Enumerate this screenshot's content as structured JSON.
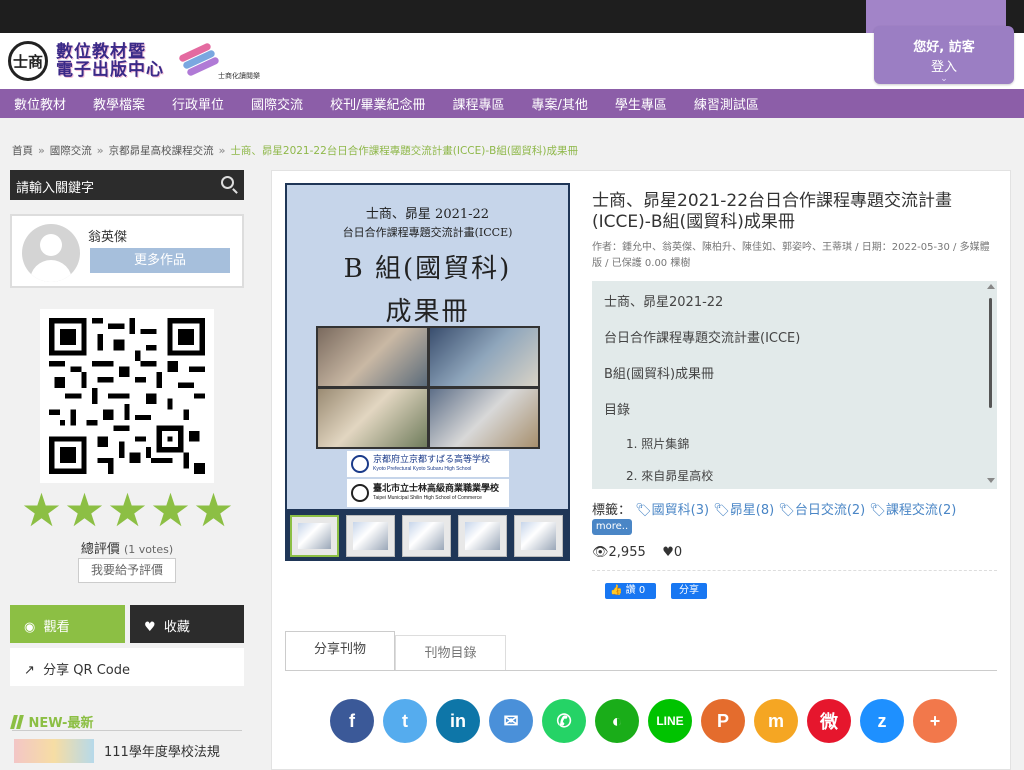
{
  "header": {
    "logo_seal": "士商",
    "logo_line1": "數位教材暨",
    "logo_line2": "電子出版中心",
    "logo_sub": "士商化讀閱樂",
    "greeting": "您好, 訪客",
    "login_label": "登入"
  },
  "nav": [
    "數位教材",
    "教學檔案",
    "行政單位",
    "國際交流",
    "校刊/畢業紀念冊",
    "課程專區",
    "專案/其他",
    "學生專區",
    "練習測試區"
  ],
  "breadcrumb": {
    "items": [
      "首頁",
      "國際交流",
      "京都昴星高校課程交流"
    ],
    "current": "士商、昴星2021-22台日合作課程專題交流計畫(ICCE)-B組(國貿科)成果冊"
  },
  "sidebar": {
    "search_placeholder": "請輸入關鍵字",
    "author_name": "翁英傑",
    "more_works": "更多作品",
    "stars": 5,
    "rating_label": "總評價",
    "votes": "(1 votes)",
    "rate_button": "我要給予評價",
    "view_button": "觀看",
    "fav_button": "收藏",
    "share_qr": "分享 QR Code",
    "new_heading": "NEW-最新",
    "new_item_title": "111學年度學校法規"
  },
  "cover": {
    "line1": "士商、昴星 2021-22",
    "line2": "台日合作課程專題交流計畫(ICCE)",
    "line3": "B 組(國貿科)",
    "line4": "成果冊",
    "school1": "京都府立京都すばる高等学校",
    "school1_en": "Kyoto Prefectural Kyoto Subaru High School",
    "school2": "臺北市立士林高級商業職業學校",
    "school2_en": "Taipei Municipal Shilin High School of Commerce"
  },
  "publication": {
    "title": "士商、昴星2021-22台日合作課程專題交流計畫(ICCE)-B組(國貿科)成果冊",
    "meta": "作者：鍾允中、翁英傑、陳柏升、陳佳如、郭姿吟、王蒂琪 / 日期：2022-05-30 / 多媒體版 / 已保護 0.00 棵樹",
    "toc": [
      "士商、昴星2021-22",
      "台日合作課程專題交流計畫(ICCE)",
      "B組(國貿科)成果冊",
      "目錄",
      "1. 照片集錦",
      "2. 來自昴星高校"
    ],
    "tags_label": "標籤：",
    "tags": [
      "國貿科(3)",
      "昴星(8)",
      "台日交流(2)",
      "課程交流(2)"
    ],
    "more_tags": "more..",
    "views": "2,955",
    "likes": "0",
    "fb_like": "讚 0",
    "fb_share": "分享"
  },
  "tabs": [
    "分享刊物",
    "刊物目錄"
  ],
  "share_icons": [
    {
      "name": "facebook-icon",
      "glyph": "f",
      "color": "#3b5998"
    },
    {
      "name": "twitter-icon",
      "glyph": "t",
      "color": "#55acee"
    },
    {
      "name": "linkedin-icon",
      "glyph": "in",
      "color": "#0e76a8"
    },
    {
      "name": "email-icon",
      "glyph": "✉",
      "color": "#4a90d9"
    },
    {
      "name": "whatsapp-icon",
      "glyph": "✆",
      "color": "#25d366"
    },
    {
      "name": "wechat-icon",
      "glyph": "◐",
      "color": "#1aad19"
    },
    {
      "name": "line-icon",
      "glyph": "LINE",
      "color": "#00c300"
    },
    {
      "name": "plurk-icon",
      "glyph": "P",
      "color": "#e46c2d"
    },
    {
      "name": "mewe-icon",
      "glyph": "m",
      "color": "#f5a623"
    },
    {
      "name": "weibo-icon",
      "glyph": "微",
      "color": "#e6162d"
    },
    {
      "name": "qzone-icon",
      "glyph": "z",
      "color": "#1e90ff"
    },
    {
      "name": "more-share-icon",
      "glyph": "+",
      "color": "#f2784b"
    }
  ]
}
